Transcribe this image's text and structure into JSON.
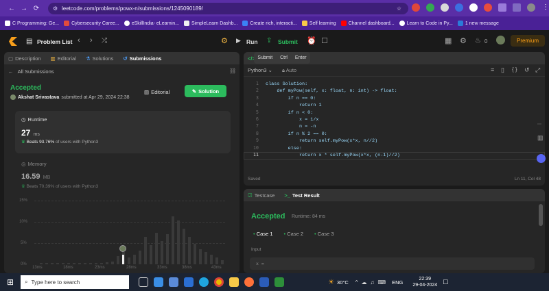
{
  "browser": {
    "url": "leetcode.com/problems/powx-n/submissions/1245090189/",
    "bookmarks": [
      "C Programming: Ge...",
      "Cybersecurity Caree...",
      "eSkillIndia- eLearnin...",
      "SimpleLearn Dashb...",
      "Create rich, interacti...",
      "Self learning",
      "Channel dashboard...",
      "Learn to Code in Py...",
      "1 new message"
    ]
  },
  "header": {
    "problem_list": "Problem List",
    "run": "Run",
    "submit": "Submit",
    "streak": "0",
    "premium": "Premium",
    "tooltip": {
      "label": "Submit",
      "key1": "Ctrl",
      "key2": "Enter"
    }
  },
  "left": {
    "tabs": [
      "Description",
      "Editorial",
      "Solutions",
      "Submissions"
    ],
    "back": "All Submissions",
    "status": "Accepted",
    "author": "Akshat Srivastava",
    "submitted": "submitted at Apr 29, 2024 22:38",
    "editorial_btn": "Editorial",
    "solution_btn": "Solution",
    "runtime": {
      "title": "Runtime",
      "value": "27",
      "unit": "ms",
      "beats_pct": "Beats 93.76%",
      "beats_rest": "of users with Python3"
    },
    "memory": {
      "title": "Memory",
      "value": "16.59",
      "unit": "MB",
      "beats_pct": "Beats 70.39%",
      "beats_rest": "of users with Python3"
    },
    "chart": {
      "y_ticks": [
        "15%",
        "10%",
        "5%",
        "0%"
      ],
      "x_ticks": [
        "13ms",
        "18ms",
        "23ms",
        "28ms",
        "33ms",
        "38ms",
        "43ms"
      ]
    }
  },
  "editor": {
    "language": "Python3",
    "mode": "Auto",
    "lines": [
      "class Solution:",
      "    def myPow(self, x: float, n: int) -> float:",
      "        if n == 0:",
      "            return 1",
      "        if n < 0:",
      "            x = 1/x",
      "            n = -n",
      "        if n % 2 == 0:",
      "            return self.myPow(x*x, n//2)",
      "        else:",
      "            return x * self.myPow(x*x, (n-1)//2)"
    ],
    "saved": "Saved",
    "cursor": "Ln 11, Col 48"
  },
  "result": {
    "tabs": [
      "Testcase",
      "Test Result"
    ],
    "status": "Accepted",
    "runtime": "Runtime: 84 ms",
    "cases": [
      "Case 1",
      "Case 2",
      "Case 3"
    ],
    "input_label": "Input",
    "input_value": "x ="
  },
  "taskbar": {
    "search": "Type here to search",
    "weather": "30°C",
    "lang": "ENG",
    "time": "22:39",
    "date": "29-04-2024"
  }
}
